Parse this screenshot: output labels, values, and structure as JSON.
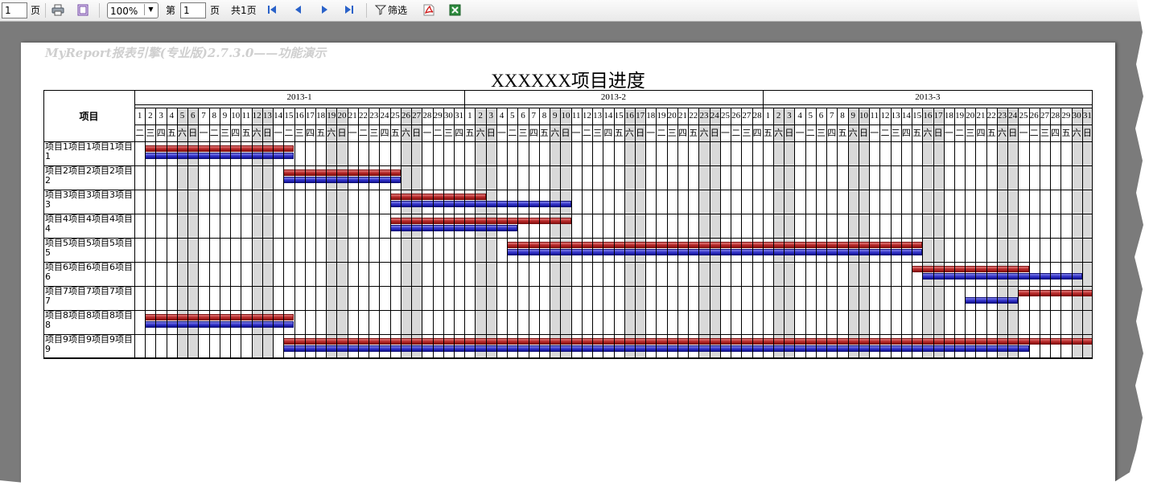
{
  "toolbar": {
    "page_input": "1",
    "page_unit_label": "页",
    "zoom": "100%",
    "goto_prefix": "第",
    "goto_input": "1",
    "goto_suffix": "页",
    "total_pages": "共1页",
    "filter_label": "筛选",
    "icons": [
      "print-icon",
      "copy-icon",
      "first-page-icon",
      "prev-page-icon",
      "next-page-icon",
      "last-page-icon",
      "filter-icon",
      "pdf-icon",
      "excel-icon"
    ]
  },
  "report": {
    "watermark": "MyReport报表引擎(专业版)2.7.3.0——功能演示",
    "title": "XXXXXX项目进度",
    "column_header": "项目"
  },
  "chart_data": {
    "type": "gantt",
    "months": [
      {
        "label": "2013-1",
        "days": 31,
        "first_weekday": 2
      },
      {
        "label": "2013-2",
        "days": 28,
        "first_weekday": 5
      },
      {
        "label": "2013-3",
        "days": 31,
        "first_weekday": 5
      }
    ],
    "weekday_labels": [
      "日",
      "一",
      "二",
      "三",
      "四",
      "五",
      "六"
    ],
    "tasks": [
      {
        "name": "项目1项目1项目1项目1",
        "plan": [
          "2013-01-02",
          "2013-01-15"
        ],
        "actual": [
          "2013-01-02",
          "2013-01-15"
        ]
      },
      {
        "name": "项目2项目2项目2项目2",
        "plan": [
          "2013-01-15",
          "2013-01-25"
        ],
        "actual": [
          "2013-01-15",
          "2013-01-25"
        ]
      },
      {
        "name": "项目3项目3项目3项目3",
        "plan": [
          "2013-01-25",
          "2013-02-02"
        ],
        "actual": [
          "2013-01-25",
          "2013-02-10"
        ]
      },
      {
        "name": "项目4项目4项目4项目4",
        "plan": [
          "2013-01-25",
          "2013-02-10"
        ],
        "actual": [
          "2013-01-25",
          "2013-02-05"
        ]
      },
      {
        "name": "项目5项目5项目5项目5",
        "plan": [
          "2013-02-05",
          "2013-03-15"
        ],
        "actual": [
          "2013-02-05",
          "2013-03-15"
        ]
      },
      {
        "name": "项目6项目6项目6项目6",
        "plan": [
          "2013-03-15",
          "2013-03-25"
        ],
        "actual": [
          "2013-03-16",
          "2013-03-30"
        ]
      },
      {
        "name": "项目7项目7项目7项目7",
        "plan": [
          "2013-03-25",
          "2013-03-31"
        ],
        "actual": [
          "2013-03-20",
          "2013-03-24"
        ]
      },
      {
        "name": "项目8项目8项目8项目8",
        "plan": [
          "2013-01-02",
          "2013-01-15"
        ],
        "actual": [
          "2013-01-02",
          "2013-01-15"
        ]
      },
      {
        "name": "项目9项目9项目9项目9",
        "plan": [
          "2013-01-15",
          "2013-03-31"
        ],
        "actual": [
          "2013-01-15",
          "2013-03-25"
        ]
      }
    ],
    "colors": {
      "plan": "#b22323",
      "actual": "#2b2bc4",
      "weekend": "#d9d9d9"
    }
  }
}
